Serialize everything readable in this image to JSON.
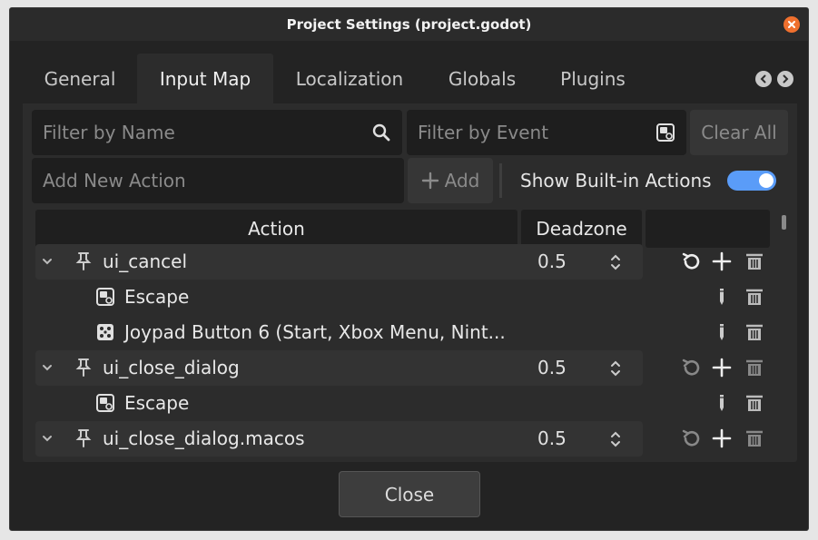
{
  "window": {
    "title": "Project Settings (project.godot)"
  },
  "tabs": [
    {
      "label": "General"
    },
    {
      "label": "Input Map",
      "active": true
    },
    {
      "label": "Localization"
    },
    {
      "label": "Globals"
    },
    {
      "label": "Plugins"
    }
  ],
  "filters": {
    "name_placeholder": "Filter by Name",
    "event_placeholder": "Filter by Event",
    "clear_all": "Clear All"
  },
  "add_action": {
    "placeholder": "Add New Action",
    "add_label": "Add",
    "show_builtin_label": "Show Built-in Actions",
    "show_builtin_enabled": true
  },
  "columns": {
    "action": "Action",
    "deadzone": "Deadzone"
  },
  "actions": [
    {
      "name": "ui_cancel",
      "deadzone": "0.5",
      "events": [
        {
          "type": "keyboard",
          "label": "Escape"
        },
        {
          "type": "joypad",
          "label": "Joypad Button 6 (Start, Xbox Menu, Nint..."
        }
      ]
    },
    {
      "name": "ui_close_dialog",
      "deadzone": "0.5",
      "events": [
        {
          "type": "keyboard",
          "label": "Escape"
        }
      ]
    },
    {
      "name": "ui_close_dialog.macos",
      "deadzone": "0.5",
      "events": []
    }
  ],
  "footer": {
    "close_label": "Close"
  },
  "colors": {
    "accent": "#5a9cf8",
    "close_button": "#f0702e",
    "background": "#232323",
    "panel": "#2c2c2c"
  }
}
